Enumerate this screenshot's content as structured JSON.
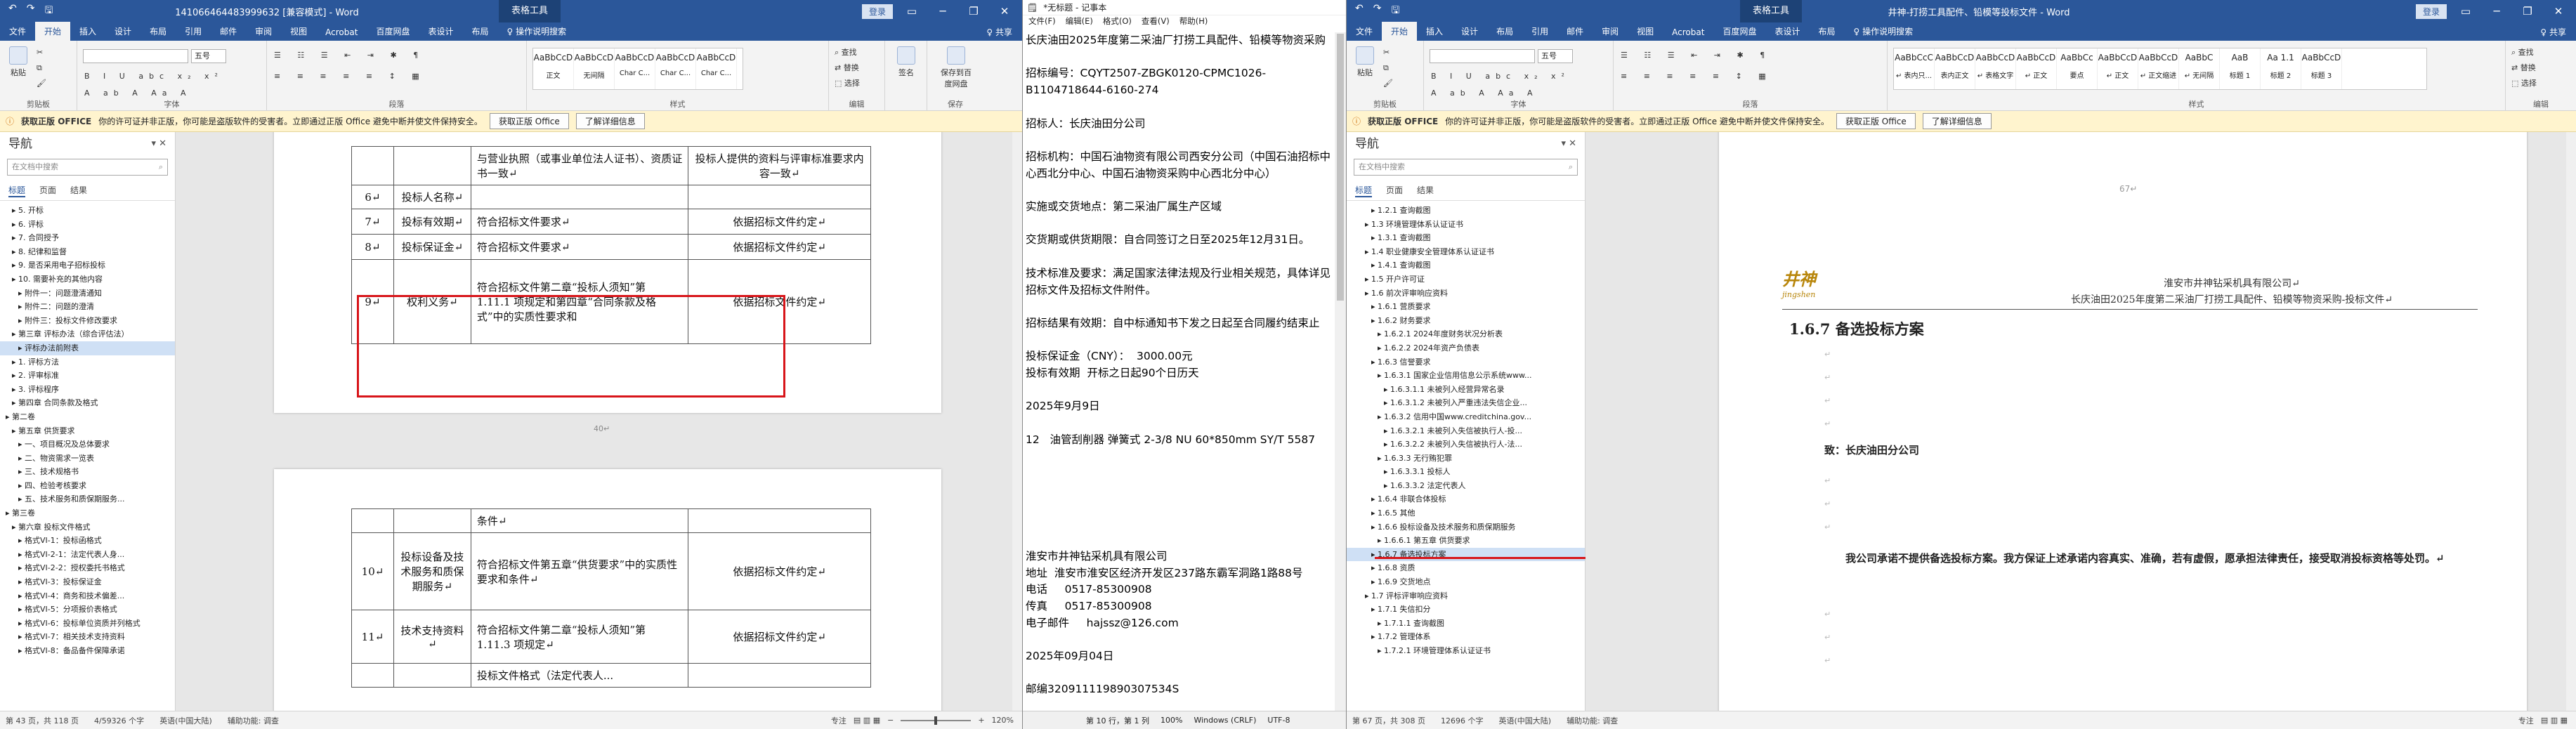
{
  "w1": {
    "title": "14106646448399963​2 [兼容模式] - Word",
    "ctx_tab": "表格工具",
    "login": "登录",
    "qa": [
      "↶",
      "↷",
      "🖫"
    ],
    "tabs": [
      "文件",
      "开始",
      "插入",
      "设计",
      "布局",
      "引用",
      "邮件",
      "审阅",
      "视图",
      "Acrobat",
      "百度网盘",
      "表设计",
      "布局",
      "♀ 操作说明搜索"
    ],
    "share": "♀ 共享",
    "ribbon": {
      "paste": "粘贴",
      "clipboard": "剪贴板",
      "font": "字体",
      "para": "段落",
      "styles": "样式",
      "edit": "编辑",
      "find": "查找",
      "replace": "替换",
      "select": "选择",
      "sign": "签名",
      "save_baidu": "保存到百度网盘",
      "save": "保存",
      "style_names": [
        "AaBbCcD",
        "AaBbCcD",
        "AaBbCcD",
        "AaBbCcD",
        "AaBbCcD"
      ],
      "style_labels": [
        "正文",
        "无间隔",
        "Char C...",
        "Char C...",
        "Char C..."
      ],
      "font_size": "五号"
    },
    "msg": {
      "label": "获取正版 OFFICE",
      "text": "你的许可证并非正版，你可能是盗版软件的受害者。立即通过正版 Office 避免中断并使文件保持安全。",
      "btn1": "获取正版 Office",
      "btn2": "了解详细信息"
    },
    "nav": {
      "title": "导航",
      "search": "在文档中搜索",
      "tabs": [
        "标题",
        "页面",
        "结果"
      ],
      "items": [
        "5. 开标",
        "6. 评标",
        "7. 合同授予",
        "8. 纪律和监督",
        "9. 是否采用电子招标投标",
        "10. 需要补充的其他内容",
        "附件一：问题澄清通知",
        "附件二：问题的澄清",
        "附件三：投标文件修改要求",
        "第三章 评标办法（综合评估法）",
        "评标办法前附表",
        "1. 评标方法",
        "2. 评审标准",
        "3. 评标程序",
        "第四章 合同条款及格式",
        "第二卷",
        "第五章 供货要求",
        "一、项目概况及总体要求",
        "二、物资需求一览表",
        "三、技术规格书",
        "四、检验考核要求",
        "五、技术服务和质保期服务...",
        "第三卷",
        "第六章 投标文件格式",
        "格式VI-1：投标函格式",
        "格式VI-2-1：法定代表人身...",
        "格式VI-2-2：授权委托书格式",
        "格式VI-3：投标保证金",
        "格式VI-4：商务和技术偏差...",
        "格式VI-5：分项报价表格式",
        "格式VI-6：投标单位资质并列格式",
        "格式VI-7：相关技术支持资料",
        "格式VI-8：备品备件保障承诺"
      ]
    },
    "table1": [
      {
        "no": "",
        "item": "",
        "req": "与营业执照（或事业单位法人证书）、资质证书一致↵",
        "crit": "投标人提供的资料与评审标准要求内容一致↵"
      },
      {
        "no": "6↵",
        "item": "投标人名称↵",
        "req": "",
        "crit": ""
      },
      {
        "no": "7↵",
        "item": "投标有效期↵",
        "req": "符合招标文件要求↵",
        "crit": "依据招标文件约定↵"
      },
      {
        "no": "8↵",
        "item": "投标保证金↵",
        "req": "符合招标文件要求↵",
        "crit": "依据招标文件约定↵"
      },
      {
        "no": "9↵",
        "item": "权利义务↵",
        "req": "符合招标文件第二章“投标人须知”第 1.11.1 项规定和第四章“合同条款及格式”中的实质性要求和",
        "crit": "依据招标文件约定↵"
      }
    ],
    "page_num": "40↵",
    "table2": [
      {
        "no": "",
        "item": "",
        "req": "条件↵",
        "crit": ""
      },
      {
        "no": "10↵",
        "item": "投标设备及技术服务和质保期服务↵",
        "req": "符合招标文件第五章“供货要求”中的实质性要求和条件↵",
        "crit": "依据招标文件约定↵"
      },
      {
        "no": "11↵",
        "item": "技术支持资料↵",
        "req": "符合招标文件第二章“投标人须知”第 1.11.3 项规定↵",
        "crit": "依据招标文件约定↵"
      },
      {
        "no": "",
        "item": "",
        "req": "投标文件格式（法定代表人...",
        "crit": ""
      }
    ],
    "status": [
      "第 43 页，共 118 页",
      "4/59326 个字",
      "英语(中国大陆)",
      "辅助功能: 调查",
      "专注",
      "120%"
    ]
  },
  "w2": {
    "title": "*无标题 - 记事本",
    "menu": [
      "文件(F)",
      "编辑(E)",
      "格式(O)",
      "查看(V)",
      "帮助(H)"
    ],
    "lines": [
      "长庆油田2025年度第二采油厂打捞工具配件、铅模等物资采购",
      "",
      "招标编号：CQYT2507-ZBGK0120-CPMC1026-B1104718644-6160-274",
      "",
      "招标人：长庆油田分公司",
      "",
      "招标机构：中国石油物资有限公司西安分公司（中国石油招标中心西北分中心、中国石油物资采购中心西北分中心）",
      "",
      "实施或交货地点：第二采油厂属生产区域",
      "",
      "交货期或供货期限：自合同签订之日至2025年12月31日。",
      "",
      "技术标准及要求：满足国家法律法规及行业相关规范，具体详见招标文件及招标文件附件。",
      "",
      "招标结果有效期：自中标通知书下发之日起至合同履约结束止",
      "",
      "投标保证金（CNY）：  3000.00元",
      "投标有效期  开标之日起90个日历天",
      "",
      "2025年9月9日",
      "",
      "12   油管刮削器 弹簧式 2-3/8 NU 60*850mm SY/T 5587",
      "",
      "",
      "",
      "",
      "",
      "",
      "淮安市井神钻采机具有限公司",
      "地址  淮安市淮安区经济开发区237路东霸军洞路1路88号",
      "电话     0517-85300908",
      "传真     0517-85300908",
      "电子邮件     hajssz@126.com",
      "",
      "2025年09月04日",
      "",
      "邮编320911119890307534S"
    ],
    "status": [
      "第 10 行，第 1 列",
      "100%",
      "Windows (CRLF)",
      "UTF-8"
    ]
  },
  "w3": {
    "title": "井神-打捞工具配件、铅模等投标文件 - Word",
    "ctx_tab": "表格工具",
    "login": "登录",
    "qa": [
      "↶",
      "↷",
      "🖫"
    ],
    "tabs": [
      "文件",
      "开始",
      "插入",
      "设计",
      "布局",
      "引用",
      "邮件",
      "审阅",
      "视图",
      "Acrobat",
      "百度网盘",
      "表设计",
      "布局",
      "♀ 操作说明搜索"
    ],
    "share": "♀ 共享",
    "ribbon": {
      "paste": "粘贴",
      "clipboard": "剪贴板",
      "font": "字体",
      "para": "段落",
      "styles": "样式",
      "edit": "编辑",
      "font_size": "五号",
      "style_names": [
        "AaBbCcC",
        "AaBbCcD",
        "AaBbCcD",
        "AaBbCcD",
        "AaBbCc",
        "AaBbCcD",
        "AaBbCcD",
        "AaBbC",
        "AaB",
        "Aa 1.1",
        "AaBbCcD"
      ],
      "style_labels": [
        "↵ 表内只...",
        "表内正文",
        "↵ 表格文字",
        "↵ 正文",
        "要点",
        "↵ 正文",
        "↵ 正文缩进",
        "↵ 无间隔",
        "标题 1",
        "标题 2",
        "标题 3"
      ],
      "find": "查找",
      "replace": "替换",
      "select": "选择"
    },
    "msg": {
      "label": "获取正版 OFFICE",
      "text": "你的许可证并非正版，你可能是盗版软件的受害者。立即通过正版 Office 避免中断并使文件保持安全。",
      "btn1": "获取正版 Office",
      "btn2": "了解详细信息"
    },
    "nav": {
      "title": "导航",
      "search": "在文档中搜索",
      "tabs": [
        "标题",
        "页面",
        "结果"
      ],
      "items": [
        "1.2.1 查询截图",
        "1.3 环境管理体系认证证书",
        "1.3.1 查询截图",
        "1.4 职业健康安全管理体系认证证书",
        "1.4.1 查询截图",
        "1.5 开户许可证",
        "1.6 前次评审响应资料",
        "1.6.1 营质要求",
        "1.6.2 财务要求",
        "1.6.2.1 2024年度财务状况分析表",
        "1.6.2.2 2024年资产负债表",
        "1.6.3 信誉要求",
        "1.6.3.1 国家企业信用信息公示系统www...",
        "1.6.3.1.1 未被列入经营异常名录",
        "1.6.3.1.2 未被列入严重违法失信企业...",
        "1.6.3.2 信用中国www.creditchina.gov...",
        "1.6.3.2.1 未被列入失信被执行人-投...",
        "1.6.3.2.2 未被列入失信被执行人-法...",
        "1.6.3.3 无行贿犯罪",
        "1.6.3.3.1 投标人",
        "1.6.3.3.2 法定代表人",
        "1.6.4 非联合体投标",
        "1.6.5 其他",
        "1.6.6 投标设备及技术服务和质保期服务",
        "1.6.6.1 第五章 供货要求",
        "1.6.7 备选投标方案",
        "1.6.8 资质",
        "1.6.9 交货地点",
        "1.7 评标评审响应资料",
        "1.7.1 失信扣分",
        "1.7.1.1 查询截图",
        "1.7.2 管理体系",
        "1.7.2.1 环境管理体系认证证书"
      ]
    },
    "page_top": "67↵",
    "company": "淮安市井神钻采机具有限公司↵",
    "subtitle": "长庆油田2025年度第二采油厂打捞工具配件、铅模等物资采购-投标文件↵",
    "logo_text": "井神",
    "logo_sub": "jingshen",
    "heading": "1.6.7 备选投标方案",
    "to": "致：长庆油田分公司",
    "body": "我公司承诺不提供备选投标方案。我方保证上述承诺内容真实、准确，若有虚假，愿承担法律责任，接受取消投标资格等处罚。↵",
    "status": [
      "第 67 页，共 308 页",
      "12696 个字",
      "英语(中国大陆)",
      "辅助功能: 调查",
      "专注"
    ]
  }
}
